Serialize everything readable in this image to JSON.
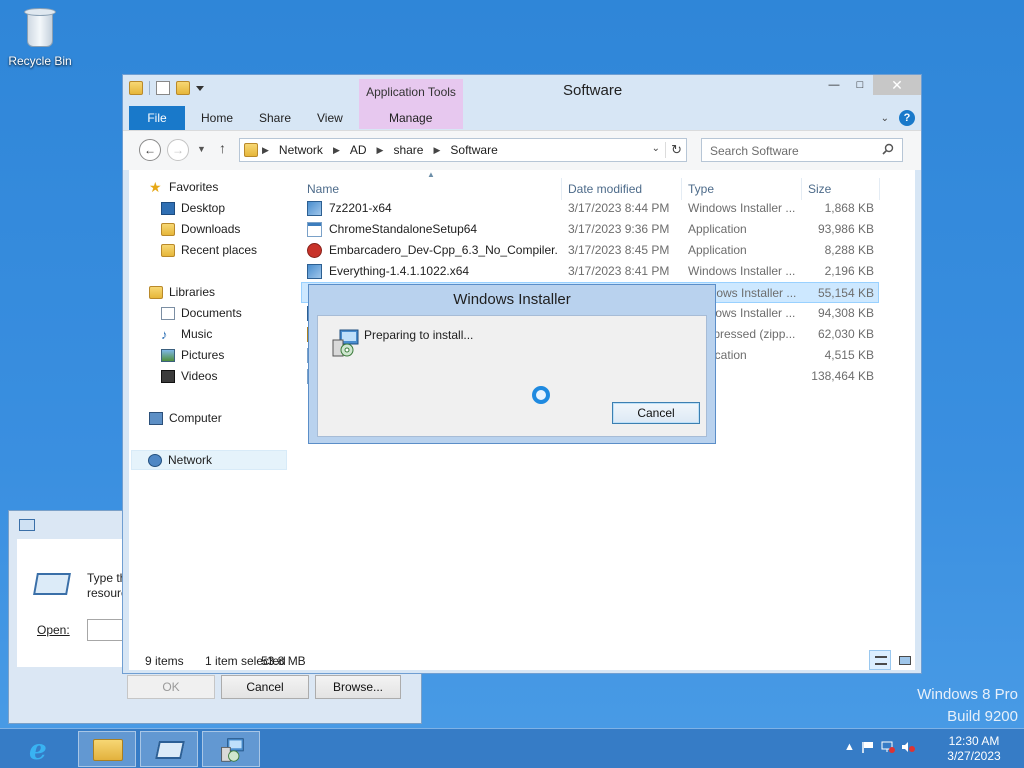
{
  "desktop": {
    "recycle_bin_label": "Recycle Bin",
    "watermark_line1": "Windows 8 Pro",
    "watermark_line2": "Build 9200"
  },
  "run_dialog": {
    "description": "Type the\nresource",
    "open_label": "Open:",
    "open_value": "",
    "ok_label": "OK",
    "cancel_label": "Cancel",
    "browse_label": "Browse..."
  },
  "explorer": {
    "title": "Software",
    "contextual_tab": "Application Tools",
    "tabs": {
      "file": "File",
      "home": "Home",
      "share": "Share",
      "view": "View",
      "manage": "Manage"
    },
    "breadcrumbs": [
      "Network",
      "AD",
      "share",
      "Software"
    ],
    "search_placeholder": "Search Software",
    "nav": {
      "favorites": "Favorites",
      "desktop": "Desktop",
      "downloads": "Downloads",
      "recent": "Recent places",
      "libraries": "Libraries",
      "documents": "Documents",
      "music": "Music",
      "pictures": "Pictures",
      "videos": "Videos",
      "computer": "Computer",
      "network": "Network"
    },
    "columns": {
      "name": "Name",
      "date": "Date modified",
      "type": "Type",
      "size": "Size"
    },
    "files": [
      {
        "name": "7z2201-x64",
        "date": "3/17/2023 8:44 PM",
        "type": "Windows Installer ...",
        "size": "1,868 KB",
        "icon": "installer-icon"
      },
      {
        "name": "ChromeStandaloneSetup64",
        "date": "3/17/2023 9:36 PM",
        "type": "Application",
        "size": "93,986 KB",
        "icon": "application-icon"
      },
      {
        "name": "Embarcadero_Dev-Cpp_6.3_No_Compiler...",
        "date": "3/17/2023 8:45 PM",
        "type": "Application",
        "size": "8,288 KB",
        "icon": "devcpp-icon"
      },
      {
        "name": "Everything-1.4.1.1022.x64",
        "date": "3/17/2023 8:41 PM",
        "type": "Windows Installer ...",
        "size": "2,196 KB",
        "icon": "installer-icon"
      },
      {
        "name": "",
        "date": "",
        "type": "Windows Installer ...",
        "size": "55,154 KB",
        "icon": "installer-icon"
      },
      {
        "name": "",
        "date": "",
        "type": "Windows Installer ...",
        "size": "94,308 KB",
        "icon": "installer-icon"
      },
      {
        "name": "",
        "date": "",
        "type": "Compressed (zipp...",
        "size": "62,030 KB",
        "icon": "zip-icon"
      },
      {
        "name": "",
        "date": "",
        "type": "Application",
        "size": "4,515 KB",
        "icon": "application-icon"
      },
      {
        "name": "",
        "date": "",
        "type": "File",
        "size": "138,464 KB",
        "icon": "file-icon"
      }
    ],
    "status": {
      "count": "9 items",
      "selected": "1 item selected",
      "size": "53.8 MB"
    }
  },
  "installer_dialog": {
    "title": "Windows Installer",
    "message": "Preparing to install...",
    "cancel_label": "Cancel"
  },
  "taskbar": {
    "time": "12:30 AM",
    "date": "3/27/2023"
  }
}
